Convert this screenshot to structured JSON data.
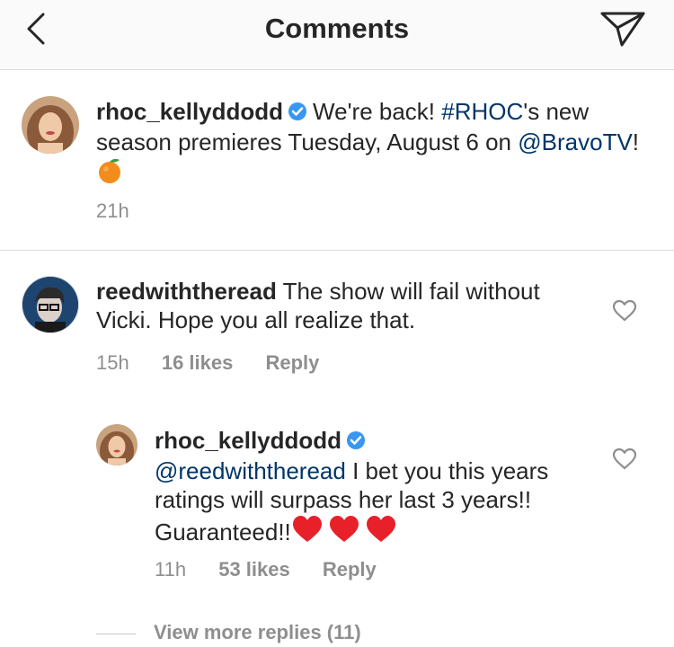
{
  "header": {
    "title": "Comments",
    "back_icon": "chevron-left-icon",
    "share_icon": "paper-plane-icon"
  },
  "caption": {
    "username": "rhoc_kellyddodd",
    "text_1": "We're back! ",
    "hashtag": "#RHOC",
    "text_2": "'s new season premieres Tuesday, August 6 on ",
    "mention": "@BravoTV",
    "text_3": "! ",
    "emoji": "tangerine-emoji",
    "time": "21h"
  },
  "comments": [
    {
      "username": "reedwiththeread",
      "text": "The show will fail without Vicki. Hope you all realize that.",
      "time": "15h",
      "likes": "16 likes",
      "reply_label": "Reply"
    }
  ],
  "reply": {
    "username": "rhoc_kellyddodd",
    "mention": "@reedwiththeread",
    "text": " I bet you this years ratings will surpass her last 3 years!! Guaranteed!!",
    "emoji": "red-heart-emoji x3",
    "time": "11h",
    "likes": "53 likes",
    "reply_label": "Reply"
  },
  "view_more": "View more replies (11)",
  "colors": {
    "link": "#003569",
    "meta": "#8e8e8e",
    "verified": "#3897f0",
    "divider": "#dbdbdb"
  }
}
